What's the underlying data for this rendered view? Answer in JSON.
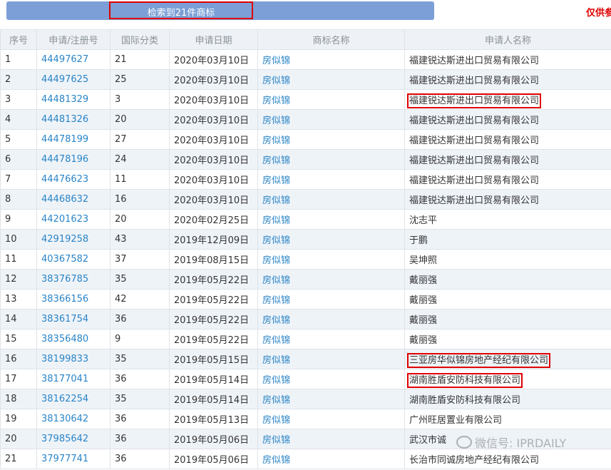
{
  "toolbar": {
    "result_label": "检索到21件商标",
    "disclaimer": "仅供参"
  },
  "table": {
    "headers": [
      "序号",
      "申请/注册号",
      "国际分类",
      "申请日期",
      "商标名称",
      "申请人名称"
    ],
    "rows": [
      {
        "no": "1",
        "reg": "44497627",
        "cls": "21",
        "date": "2020年03月10日",
        "mark": "房似锦",
        "applicant": "福建锐达斯进出口贸易有限公司"
      },
      {
        "no": "2",
        "reg": "44497625",
        "cls": "25",
        "date": "2020年03月10日",
        "mark": "房似锦",
        "applicant": "福建锐达斯进出口贸易有限公司"
      },
      {
        "no": "3",
        "reg": "44481329",
        "cls": "3",
        "date": "2020年03月10日",
        "mark": "房似锦",
        "applicant": "福建锐达斯进出口贸易有限公司"
      },
      {
        "no": "4",
        "reg": "44481326",
        "cls": "20",
        "date": "2020年03月10日",
        "mark": "房似锦",
        "applicant": "福建锐达斯进出口贸易有限公司"
      },
      {
        "no": "5",
        "reg": "44478199",
        "cls": "27",
        "date": "2020年03月10日",
        "mark": "房似锦",
        "applicant": "福建锐达斯进出口贸易有限公司"
      },
      {
        "no": "6",
        "reg": "44478196",
        "cls": "24",
        "date": "2020年03月10日",
        "mark": "房似锦",
        "applicant": "福建锐达斯进出口贸易有限公司"
      },
      {
        "no": "7",
        "reg": "44476623",
        "cls": "11",
        "date": "2020年03月10日",
        "mark": "房似锦",
        "applicant": "福建锐达斯进出口贸易有限公司"
      },
      {
        "no": "8",
        "reg": "44468632",
        "cls": "16",
        "date": "2020年03月10日",
        "mark": "房似锦",
        "applicant": "福建锐达斯进出口贸易有限公司"
      },
      {
        "no": "9",
        "reg": "44201623",
        "cls": "20",
        "date": "2020年02月25日",
        "mark": "房似锦",
        "applicant": "沈志平"
      },
      {
        "no": "10",
        "reg": "42919258",
        "cls": "43",
        "date": "2019年12月09日",
        "mark": "房似锦",
        "applicant": "于鹏"
      },
      {
        "no": "11",
        "reg": "40367582",
        "cls": "37",
        "date": "2019年08月15日",
        "mark": "房似锦",
        "applicant": "吴坤照"
      },
      {
        "no": "12",
        "reg": "38376785",
        "cls": "35",
        "date": "2019年05月22日",
        "mark": "房似锦",
        "applicant": "戴丽强"
      },
      {
        "no": "13",
        "reg": "38366156",
        "cls": "42",
        "date": "2019年05月22日",
        "mark": "房似锦",
        "applicant": "戴丽强"
      },
      {
        "no": "14",
        "reg": "38361754",
        "cls": "36",
        "date": "2019年05月22日",
        "mark": "房似锦",
        "applicant": "戴丽强"
      },
      {
        "no": "15",
        "reg": "38356480",
        "cls": "9",
        "date": "2019年05月22日",
        "mark": "房似锦",
        "applicant": "戴丽强"
      },
      {
        "no": "16",
        "reg": "38199833",
        "cls": "35",
        "date": "2019年05月15日",
        "mark": "房似锦",
        "applicant": "三亚房华似锦房地产经纪有限公司"
      },
      {
        "no": "17",
        "reg": "38177041",
        "cls": "36",
        "date": "2019年05月14日",
        "mark": "房似锦",
        "applicant": "湖南胜盾安防科技有限公司"
      },
      {
        "no": "18",
        "reg": "38162254",
        "cls": "35",
        "date": "2019年05月14日",
        "mark": "房似锦",
        "applicant": "湖南胜盾安防科技有限公司"
      },
      {
        "no": "19",
        "reg": "38130642",
        "cls": "36",
        "date": "2019年05月13日",
        "mark": "房似锦",
        "applicant": "广州旺居置业有限公司"
      },
      {
        "no": "20",
        "reg": "37985642",
        "cls": "36",
        "date": "2019年05月06日",
        "mark": "房似锦",
        "applicant": "武汉市诚"
      },
      {
        "no": "21",
        "reg": "37977741",
        "cls": "36",
        "date": "2019年05月06日",
        "mark": "房似锦",
        "applicant": "长治市同诚房地产经纪有限公司"
      }
    ]
  },
  "watermark": "微信号: IPRDAILY"
}
